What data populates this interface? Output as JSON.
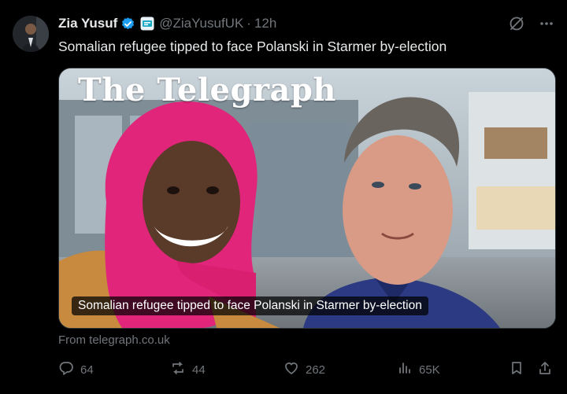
{
  "author": {
    "name": "Zia Yusuf",
    "handle": "@ZiaYusufUK",
    "time": "12h"
  },
  "tweet_text": "Somalian refugee tipped to face Polanski in Starmer by-election",
  "card": {
    "masthead": "The Telegraph",
    "caption": "Somalian refugee tipped to face Polanski in Starmer by-election",
    "source": "From telegraph.co.uk"
  },
  "actions": {
    "replies": "64",
    "reposts": "44",
    "likes": "262",
    "views": "65K"
  },
  "icons": [
    "verified-badge-icon",
    "affiliate-badge-icon",
    "grok-icon",
    "more-icon",
    "reply-icon",
    "repost-icon",
    "like-icon",
    "views-icon",
    "bookmark-icon",
    "share-icon"
  ],
  "colors": {
    "background": "#000000",
    "muted": "#71767b",
    "verified": "#1d9bf0",
    "hijab": "#e0257a"
  }
}
